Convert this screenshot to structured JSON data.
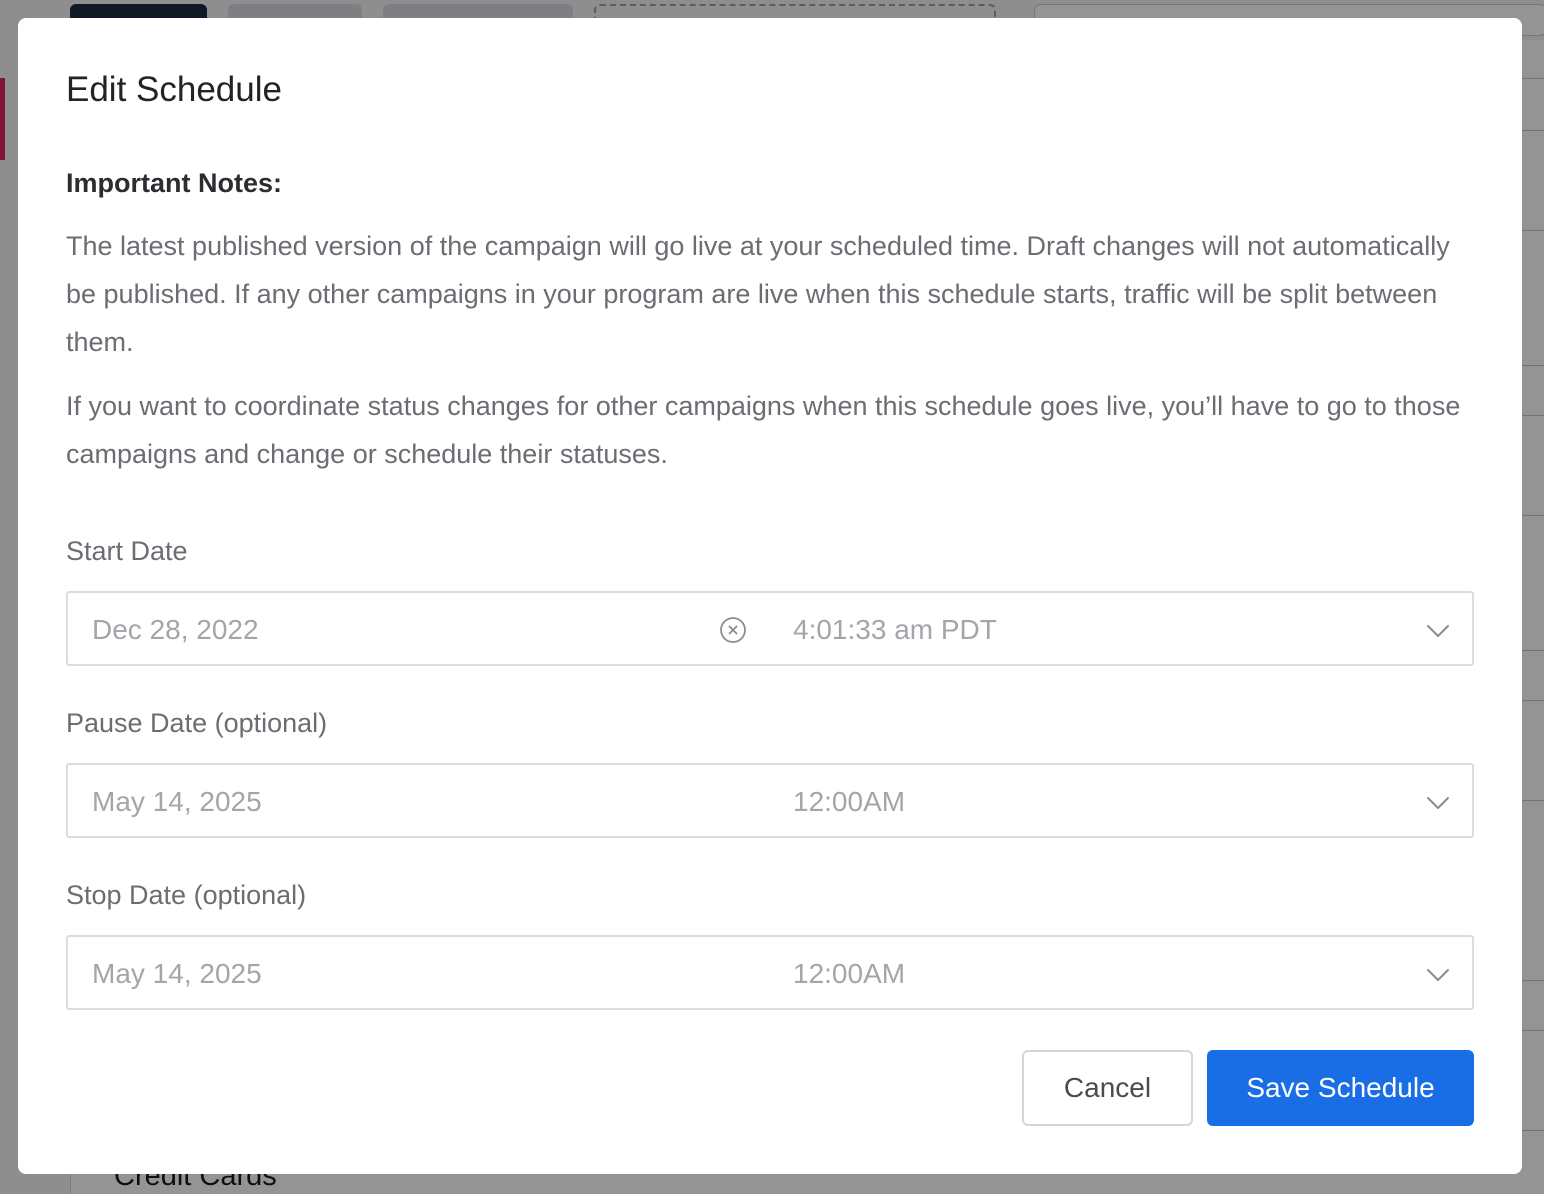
{
  "background": {
    "visible_text": "Credit Cards"
  },
  "modal": {
    "title": "Edit Schedule",
    "notes_heading": "Important Notes:",
    "note_paragraph_1": "The latest published version of the campaign will go live at your scheduled time. Draft changes will not automatically be published. If any other campaigns in your program are live when this schedule starts, traffic will be split between them.",
    "note_paragraph_2": "If you want to coordinate status changes for other campaigns when this schedule goes live, you’ll have to go to those campaigns and change or schedule their statuses.",
    "start": {
      "label": "Start Date",
      "date": "Dec 28, 2022",
      "time": "4:01:33 am PDT"
    },
    "pause": {
      "label": "Pause Date (optional)",
      "date": "May 14, 2025",
      "time": "12:00AM"
    },
    "stop": {
      "label": "Stop Date (optional)",
      "date": "May 14, 2025",
      "time": "12:00AM"
    },
    "cancel_label": "Cancel",
    "save_label": "Save Schedule"
  },
  "colors": {
    "primary_button": "#1a6ee5",
    "placeholder_text": "#a3a5aa",
    "body_text": "#6b6d72",
    "title_text": "#222326"
  },
  "icons": {
    "clear": "circle-x-icon",
    "dropdown": "chevron-down-icon"
  }
}
